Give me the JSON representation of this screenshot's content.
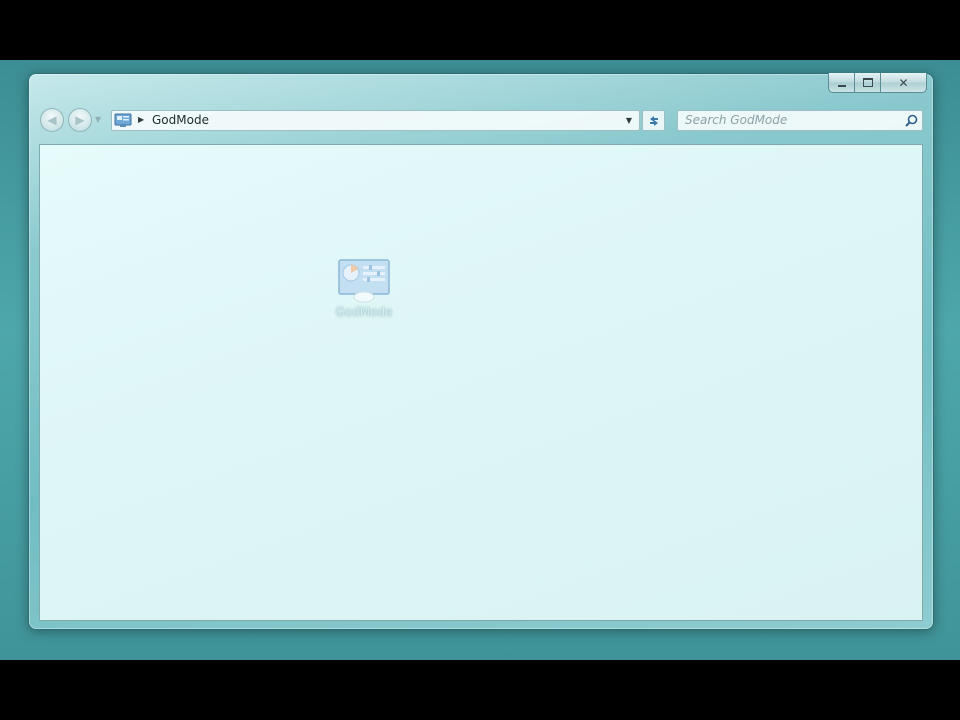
{
  "window": {
    "caption_buttons": {
      "minimize_icon": "minimize-icon",
      "maximize_icon": "maximize-icon",
      "close_glyph": "✕"
    }
  },
  "navbar": {
    "back_icon": "back-arrow-icon",
    "forward_icon": "forward-arrow-icon",
    "address": {
      "location_icon": "control-panel-icon",
      "path": "GodMode"
    },
    "refresh_icon": "refresh-icon",
    "search": {
      "placeholder": "Search GodMode",
      "icon": "search-icon"
    }
  },
  "content": {
    "items": [
      {
        "label": "GodMode",
        "icon": "control-panel-icon"
      }
    ]
  },
  "colors": {
    "desktop": "#4ea7ab",
    "content_bg": "#e2f8f8",
    "frame": "#96d2d7"
  }
}
